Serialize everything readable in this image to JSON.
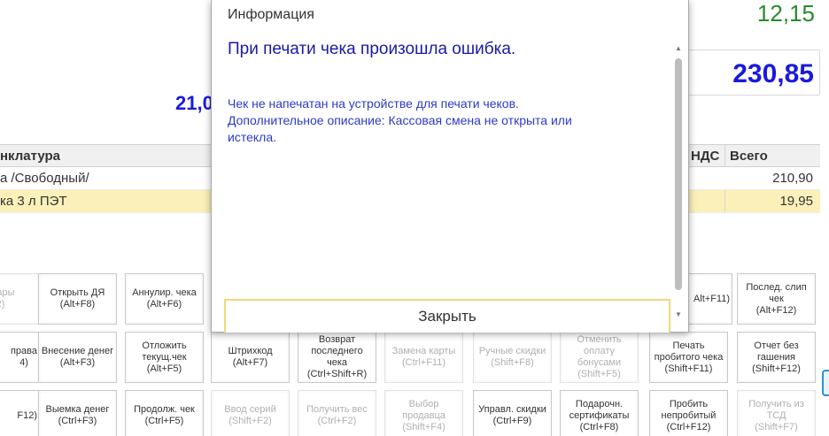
{
  "totals": {
    "top_amount": "12,15",
    "total_amount": "230,85",
    "left_amount": "21,0"
  },
  "colors": {
    "green": "#2a8a2a",
    "blue": "#1a1adc",
    "selected_row": "#fbf0b9",
    "accent_border": "#f0d77a"
  },
  "table": {
    "headers": {
      "name": "нклатура",
      "vat": "НДС",
      "total": "Всего"
    },
    "rows": [
      {
        "name": "а /Свободный/",
        "total": "210,90"
      },
      {
        "name": "ка 3 л ПЭТ",
        "total": "19,95"
      }
    ]
  },
  "buttons": {
    "row1": [
      {
        "label": "овары\n2)",
        "disabled": true
      },
      {
        "label": "Открыть ДЯ\n(Alt+F8)",
        "disabled": false
      },
      {
        "label": "Аннулир. чека\n(Alt+F6)",
        "disabled": false
      },
      {
        "label": "Alt+F11)",
        "disabled": false
      },
      {
        "label": "Послед. слип чек\n(Alt+F12)",
        "disabled": false
      }
    ],
    "row2": [
      {
        "label": "права\n4)",
        "disabled": false
      },
      {
        "label": "Внесение денег\n(Alt+F3)",
        "disabled": false
      },
      {
        "label": "Отложить текущ.чек\n(Alt+F5)",
        "disabled": false
      },
      {
        "label": "Штрихкод (Alt+F7)",
        "disabled": false
      },
      {
        "label": "Возврат последнего чека\n(Ctrl+Shift+R)",
        "disabled": false
      },
      {
        "label": "Замена карты\n(Ctrl+F11)",
        "disabled": true
      },
      {
        "label": "Ручные скидки\n(Shift+F8)",
        "disabled": true
      },
      {
        "label": "Отменить оплату бонусами (Shift+F5)",
        "disabled": true
      },
      {
        "label": "Печать пробитого чека\n(Shift+F11)",
        "disabled": false
      },
      {
        "label": "Отчет без гашения\n(Shift+F12)",
        "disabled": false
      }
    ],
    "row3": [
      {
        "label": "F12)",
        "disabled": false
      },
      {
        "label": "Выемка денег\n(Ctrl+F3)",
        "disabled": false
      },
      {
        "label": "Продолж. чек\n(Ctrl+F5)",
        "disabled": false
      },
      {
        "label": "Ввод серий\n(Shift+F2)",
        "disabled": true
      },
      {
        "label": "Получить вес\n(Ctrl+F2)",
        "disabled": true
      },
      {
        "label": "Выбор продавца\n(Shift+F4)",
        "disabled": true
      },
      {
        "label": "Управл. скидки\n(Ctrl+F9)",
        "disabled": false
      },
      {
        "label": "Подарочн. сертификаты\n(Ctrl+F8)",
        "disabled": false
      },
      {
        "label": "Пробить непробитый\n(Ctrl+F12)",
        "disabled": false
      },
      {
        "label": "Получить из ТСД\n(Shift+F7)",
        "disabled": true
      }
    ]
  },
  "dialog": {
    "title": "Информация",
    "headline": "При печати чека произошла ошибка.",
    "message": "Чек не напечатан на устройстве для печати чеков.\nДополнительное описание: Кассовая смена не открыта или истекла.",
    "close_label": "Закрыть"
  }
}
